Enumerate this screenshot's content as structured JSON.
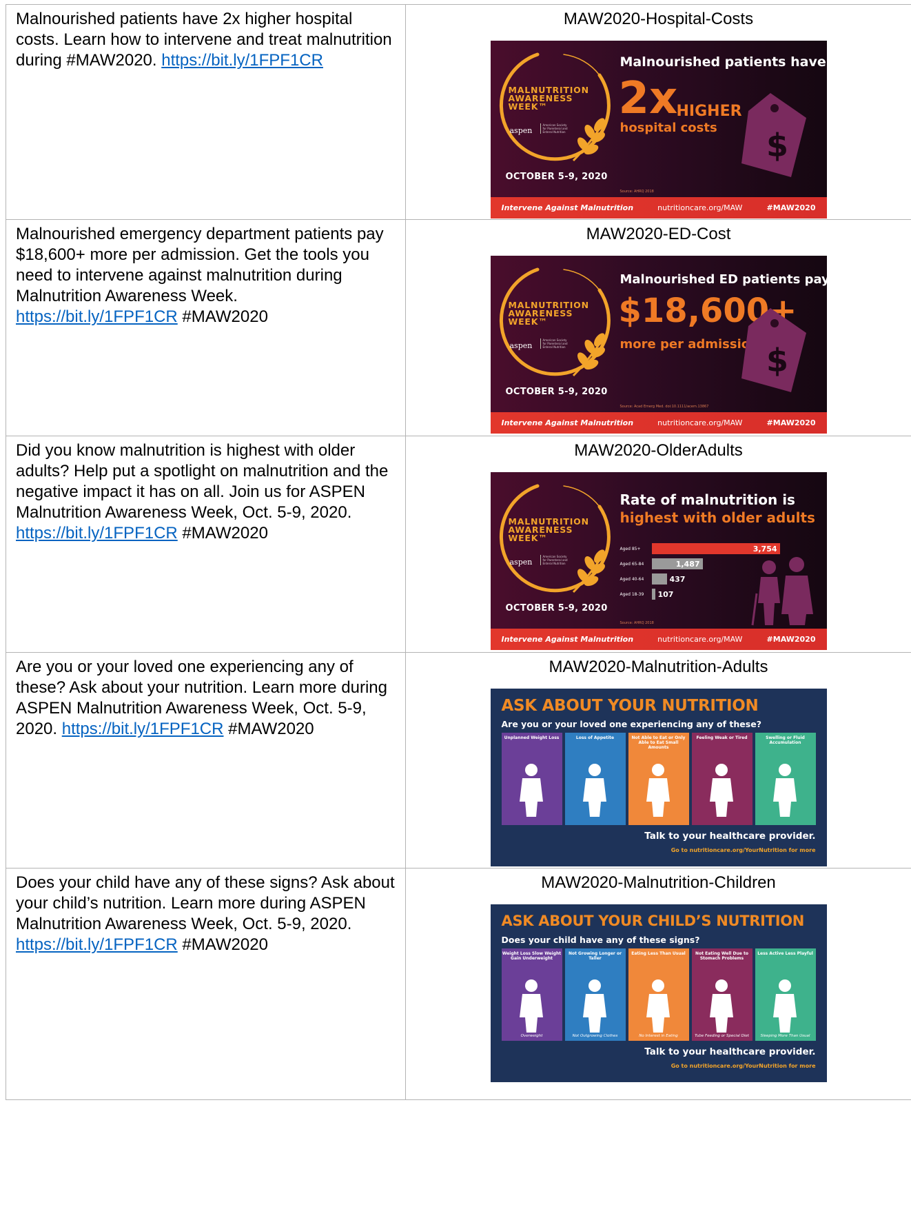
{
  "rows": [
    {
      "text_before": "Malnourished patients have 2x higher hospital costs. Learn how to intervene and treat malnutrition during #MAW2020. ",
      "link": "https://bit.ly/1FPF1CR",
      "text_after": "",
      "caption": "MAW2020-Hospital-Costs"
    },
    {
      "text_before": "Malnourished emergency department patients pay $18,600+ more per admission. Get the tools you need to intervene against malnutrition during Malnutrition Awareness Week. ",
      "link": "https://bit.ly/1FPF1CR",
      "text_after": " #MAW2020",
      "caption": "MAW2020-ED-Cost"
    },
    {
      "text_before": "Did you know malnutrition is highest with older adults? Help put a spotlight on malnutrition and the negative impact it has on all. Join us for ASPEN Malnutrition Awareness Week, Oct. 5-9, 2020. ",
      "link": "https://bit.ly/1FPF1CR",
      "text_after": " #MAW2020",
      "caption": "MAW2020-OlderAdults"
    },
    {
      "text_before": "Are you or your loved one experiencing any of these? Ask about your nutrition. Learn more during ASPEN Malnutrition Awareness Week, Oct. 5-9, 2020. ",
      "link": "https://bit.ly/1FPF1CR",
      "text_after": " #MAW2020",
      "caption": "MAW2020-Malnutrition-Adults"
    },
    {
      "text_before": "Does your child have any of these signs? Ask about your child’s nutrition. Learn more during ASPEN Malnutrition Awareness Week, Oct. 5-9, 2020. ",
      "link": "https://bit.ly/1FPF1CR",
      "text_after": " #MAW2020",
      "caption": "MAW2020-Malnutrition-Children"
    }
  ],
  "banner": {
    "logo_line1": "MALNUTRITION",
    "logo_line2": "AWARENESS",
    "logo_line3": "WEEK™",
    "aspen": "aspen",
    "aspen_small": "American Society for Parenteral and Enteral Nutrition",
    "date": "OCTOBER 5-9, 2020",
    "footer_left": "Intervene Against Malnutrition",
    "footer_mid": "nutritioncare.org/MAW",
    "footer_right": "#MAW2020",
    "dollar": "$"
  },
  "banner1": {
    "headline": "Malnourished patients have",
    "big": "2x",
    "higher": "HIGHER",
    "sub": "hospital costs",
    "source": "Source: AHRQ 2018"
  },
  "banner2": {
    "headline": "Malnourished ED patients pay",
    "big": "$18,600+",
    "sub": "more per admission",
    "source": "Source: Acad Emerg Med. doi:10.1111/acem.13867"
  },
  "banner3": {
    "headline1": "Rate of malnutrition is",
    "headline2": "highest with older adults",
    "source": "Source: AHRQ 2018"
  },
  "chart_data": {
    "type": "bar",
    "title": "Rate of malnutrition is highest with older adults",
    "categories": [
      "Aged 85+",
      "Aged 65-84",
      "Aged 40-64",
      "Aged 18-39"
    ],
    "values": [
      3754,
      1487,
      437,
      107
    ],
    "value_labels": [
      "3,754",
      "1,487",
      "437",
      "107"
    ],
    "orientation": "horizontal",
    "colors": [
      "#e2372c",
      "#9a9a9a",
      "#9a9a9a",
      "#9a9a9a"
    ]
  },
  "poster_adults": {
    "title": "ASK ABOUT YOUR NUTRITION",
    "subtitle": "Are you or your loved one experiencing any of these?",
    "panels": [
      {
        "label": "Unplanned Weight Loss",
        "caption": "",
        "color": "#6b3f98"
      },
      {
        "label": "Loss of Appetite",
        "caption": "",
        "color": "#2f7ec1"
      },
      {
        "label": "Not Able to Eat or Only Able to Eat Small Amounts",
        "caption": "",
        "color": "#f0883a"
      },
      {
        "label": "Feeling Weak or Tired",
        "caption": "",
        "color": "#8a2c5d"
      },
      {
        "label": "Swelling or Fluid Accumulation",
        "caption": "",
        "color": "#3eb28c"
      }
    ],
    "talk": "Talk to your healthcare provider.",
    "go": "Go to nutritioncare.org/YourNutrition for more"
  },
  "poster_children": {
    "title": "ASK ABOUT YOUR CHILD’S NUTRITION",
    "subtitle": "Does your child have any of these signs?",
    "panels": [
      {
        "label": "Weight Loss Slow Weight Gain Underweight",
        "caption": "Overweight",
        "color": "#6b3f98"
      },
      {
        "label": "Not Growing Longer or Taller",
        "caption": "Not Outgrowing Clothes",
        "color": "#2f7ec1"
      },
      {
        "label": "Eating Less Than Usual",
        "caption": "No Interest in Eating",
        "color": "#f0883a"
      },
      {
        "label": "Not Eating Well Due to Stomach Problems",
        "caption": "Tube Feeding or Special Diet",
        "color": "#8a2c5d"
      },
      {
        "label": "Less Active Less Playful",
        "caption": "Sleeping More Than Usual",
        "color": "#3eb28c"
      }
    ],
    "talk": "Talk to your healthcare provider.",
    "go": "Go to nutritioncare.org/YourNutrition for more"
  }
}
